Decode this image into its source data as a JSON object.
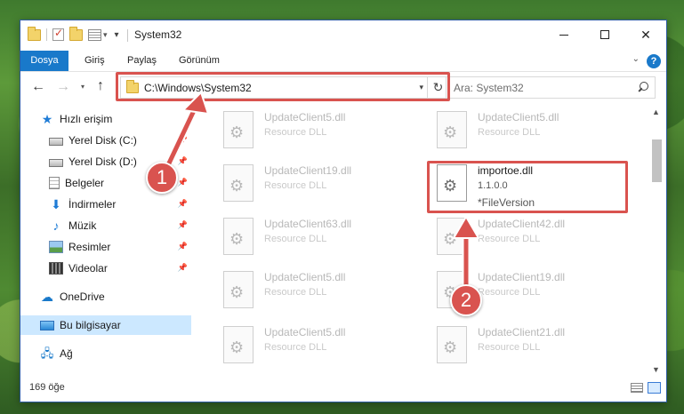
{
  "window": {
    "title": "System32",
    "controls": {
      "minimize": "minimize",
      "maximize": "maximize",
      "close": "✕"
    }
  },
  "ribbon": {
    "tabs": [
      "Dosya",
      "Giriş",
      "Paylaş",
      "Görünüm"
    ],
    "help": "?"
  },
  "navigation": {
    "address": "C:\\Windows\\System32",
    "search_placeholder": "Ara: System32"
  },
  "sidebar": {
    "items": [
      {
        "label": "Hızlı erişim",
        "icon": "star-icon"
      },
      {
        "label": "Yerel Disk (C:)",
        "icon": "disk-icon",
        "pinned": true
      },
      {
        "label": "Yerel Disk (D:)",
        "icon": "disk-icon",
        "pinned": true
      },
      {
        "label": "Belgeler",
        "icon": "documents-icon",
        "pinned": true
      },
      {
        "label": "İndirmeler",
        "icon": "download-icon",
        "pinned": true
      },
      {
        "label": "Müzik",
        "icon": "music-icon",
        "pinned": true
      },
      {
        "label": "Resimler",
        "icon": "pictures-icon",
        "pinned": true
      },
      {
        "label": "Videolar",
        "icon": "videos-icon",
        "pinned": true
      },
      {
        "label": "OneDrive",
        "icon": "cloud-icon"
      },
      {
        "label": "Bu bilgisayar",
        "icon": "computer-icon",
        "selected": true
      },
      {
        "label": "Ağ",
        "icon": "network-icon"
      }
    ]
  },
  "files": [
    {
      "name": "UpdateClient5.dll",
      "type": "Resource DLL"
    },
    {
      "name": "UpdateClient5.dll",
      "type": "Resource DLL"
    },
    {
      "name": "UpdateClient19.dll",
      "type": "Resource DLL"
    },
    {
      "name": "importoe.dll",
      "version": "1.1.0.0",
      "type": "*FileVersion",
      "highlighted": true
    },
    {
      "name": "UpdateClient63.dll",
      "type": "Resource DLL"
    },
    {
      "name": "UpdateClient42.dll",
      "type": "Resource DLL"
    },
    {
      "name": "UpdateClient5.dll",
      "type": "Resource DLL"
    },
    {
      "name": "UpdateClient19.dll",
      "type": "Resource DLL"
    },
    {
      "name": "UpdateClient5.dll",
      "type": "Resource DLL"
    },
    {
      "name": "UpdateClient21.dll",
      "type": "Resource DLL"
    }
  ],
  "status": {
    "item_count": "169 öğe"
  },
  "annotations": [
    {
      "number": "1",
      "color": "#d9534f"
    },
    {
      "number": "2",
      "color": "#d9534f"
    }
  ],
  "colors": {
    "accent": "#1979ca",
    "highlight": "#d9534f",
    "selected": "#cce8ff"
  }
}
